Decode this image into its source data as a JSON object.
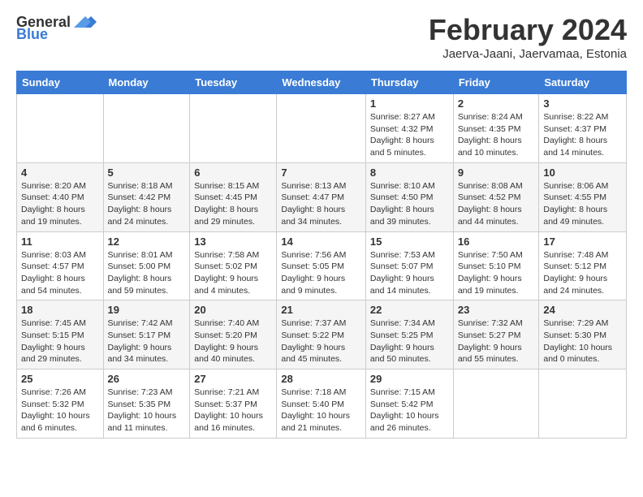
{
  "logo": {
    "text_general": "General",
    "text_blue": "Blue"
  },
  "title": "February 2024",
  "subtitle": "Jaerva-Jaani, Jaervamaa, Estonia",
  "headers": [
    "Sunday",
    "Monday",
    "Tuesday",
    "Wednesday",
    "Thursday",
    "Friday",
    "Saturday"
  ],
  "weeks": [
    [
      {
        "day": "",
        "info": ""
      },
      {
        "day": "",
        "info": ""
      },
      {
        "day": "",
        "info": ""
      },
      {
        "day": "",
        "info": ""
      },
      {
        "day": "1",
        "info": "Sunrise: 8:27 AM\nSunset: 4:32 PM\nDaylight: 8 hours and 5 minutes."
      },
      {
        "day": "2",
        "info": "Sunrise: 8:24 AM\nSunset: 4:35 PM\nDaylight: 8 hours and 10 minutes."
      },
      {
        "day": "3",
        "info": "Sunrise: 8:22 AM\nSunset: 4:37 PM\nDaylight: 8 hours and 14 minutes."
      }
    ],
    [
      {
        "day": "4",
        "info": "Sunrise: 8:20 AM\nSunset: 4:40 PM\nDaylight: 8 hours and 19 minutes."
      },
      {
        "day": "5",
        "info": "Sunrise: 8:18 AM\nSunset: 4:42 PM\nDaylight: 8 hours and 24 minutes."
      },
      {
        "day": "6",
        "info": "Sunrise: 8:15 AM\nSunset: 4:45 PM\nDaylight: 8 hours and 29 minutes."
      },
      {
        "day": "7",
        "info": "Sunrise: 8:13 AM\nSunset: 4:47 PM\nDaylight: 8 hours and 34 minutes."
      },
      {
        "day": "8",
        "info": "Sunrise: 8:10 AM\nSunset: 4:50 PM\nDaylight: 8 hours and 39 minutes."
      },
      {
        "day": "9",
        "info": "Sunrise: 8:08 AM\nSunset: 4:52 PM\nDaylight: 8 hours and 44 minutes."
      },
      {
        "day": "10",
        "info": "Sunrise: 8:06 AM\nSunset: 4:55 PM\nDaylight: 8 hours and 49 minutes."
      }
    ],
    [
      {
        "day": "11",
        "info": "Sunrise: 8:03 AM\nSunset: 4:57 PM\nDaylight: 8 hours and 54 minutes."
      },
      {
        "day": "12",
        "info": "Sunrise: 8:01 AM\nSunset: 5:00 PM\nDaylight: 8 hours and 59 minutes."
      },
      {
        "day": "13",
        "info": "Sunrise: 7:58 AM\nSunset: 5:02 PM\nDaylight: 9 hours and 4 minutes."
      },
      {
        "day": "14",
        "info": "Sunrise: 7:56 AM\nSunset: 5:05 PM\nDaylight: 9 hours and 9 minutes."
      },
      {
        "day": "15",
        "info": "Sunrise: 7:53 AM\nSunset: 5:07 PM\nDaylight: 9 hours and 14 minutes."
      },
      {
        "day": "16",
        "info": "Sunrise: 7:50 AM\nSunset: 5:10 PM\nDaylight: 9 hours and 19 minutes."
      },
      {
        "day": "17",
        "info": "Sunrise: 7:48 AM\nSunset: 5:12 PM\nDaylight: 9 hours and 24 minutes."
      }
    ],
    [
      {
        "day": "18",
        "info": "Sunrise: 7:45 AM\nSunset: 5:15 PM\nDaylight: 9 hours and 29 minutes."
      },
      {
        "day": "19",
        "info": "Sunrise: 7:42 AM\nSunset: 5:17 PM\nDaylight: 9 hours and 34 minutes."
      },
      {
        "day": "20",
        "info": "Sunrise: 7:40 AM\nSunset: 5:20 PM\nDaylight: 9 hours and 40 minutes."
      },
      {
        "day": "21",
        "info": "Sunrise: 7:37 AM\nSunset: 5:22 PM\nDaylight: 9 hours and 45 minutes."
      },
      {
        "day": "22",
        "info": "Sunrise: 7:34 AM\nSunset: 5:25 PM\nDaylight: 9 hours and 50 minutes."
      },
      {
        "day": "23",
        "info": "Sunrise: 7:32 AM\nSunset: 5:27 PM\nDaylight: 9 hours and 55 minutes."
      },
      {
        "day": "24",
        "info": "Sunrise: 7:29 AM\nSunset: 5:30 PM\nDaylight: 10 hours and 0 minutes."
      }
    ],
    [
      {
        "day": "25",
        "info": "Sunrise: 7:26 AM\nSunset: 5:32 PM\nDaylight: 10 hours and 6 minutes."
      },
      {
        "day": "26",
        "info": "Sunrise: 7:23 AM\nSunset: 5:35 PM\nDaylight: 10 hours and 11 minutes."
      },
      {
        "day": "27",
        "info": "Sunrise: 7:21 AM\nSunset: 5:37 PM\nDaylight: 10 hours and 16 minutes."
      },
      {
        "day": "28",
        "info": "Sunrise: 7:18 AM\nSunset: 5:40 PM\nDaylight: 10 hours and 21 minutes."
      },
      {
        "day": "29",
        "info": "Sunrise: 7:15 AM\nSunset: 5:42 PM\nDaylight: 10 hours and 26 minutes."
      },
      {
        "day": "",
        "info": ""
      },
      {
        "day": "",
        "info": ""
      }
    ]
  ]
}
